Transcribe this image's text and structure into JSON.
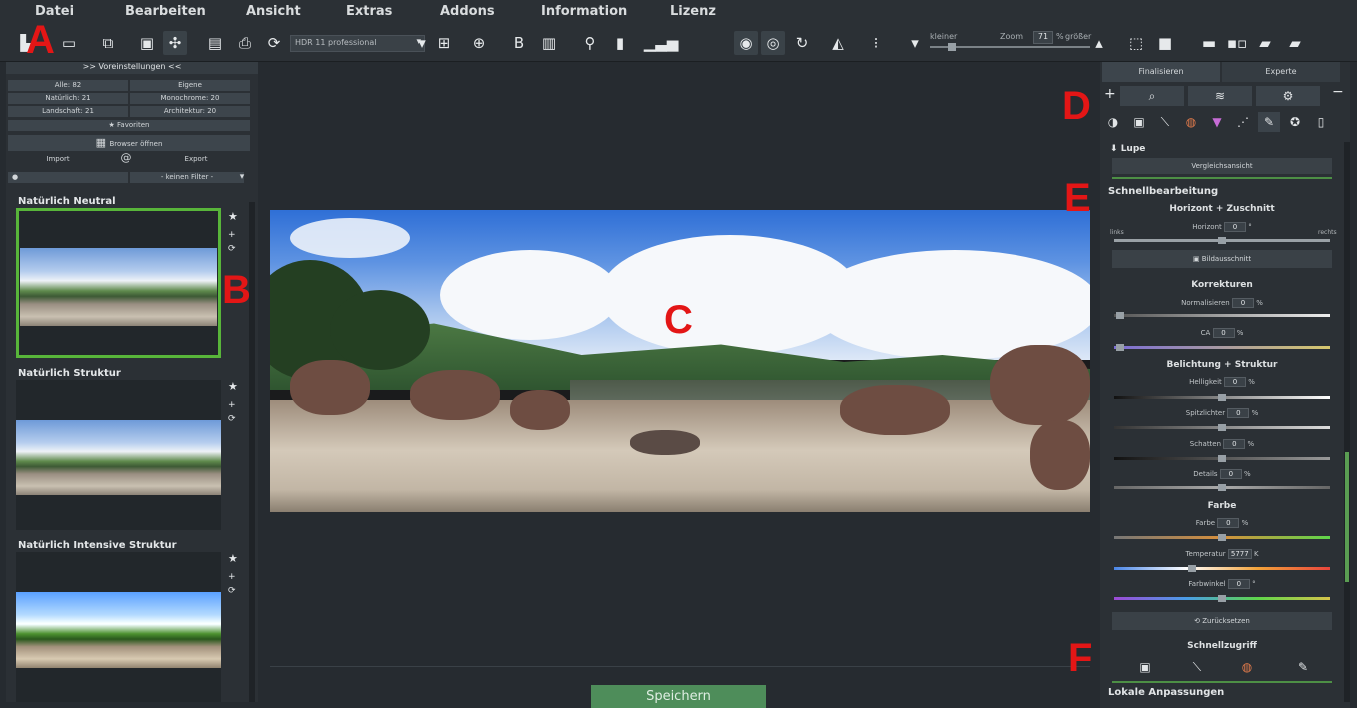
{
  "menu": [
    "Datei",
    "Bearbeiten",
    "Ansicht",
    "Extras",
    "Addons",
    "Information",
    "Lizenz"
  ],
  "toolbar": {
    "preset_select": "HDR 11 professional",
    "zoom_label": "Zoom",
    "zoom_value": "71",
    "zoom_unit": "%",
    "kleiner": "kleiner",
    "groesser": "größer"
  },
  "labels": {
    "a": "A",
    "b": "B",
    "c": "C",
    "d": "D",
    "e": "E",
    "f": "F"
  },
  "left": {
    "title": ">> Voreinstellungen <<",
    "alle": "Alle: 82",
    "eigene": "Eigene",
    "natuerlich": "Natürlich: 21",
    "monochrome": "Monochrome: 20",
    "landschaft": "Landschaft: 21",
    "architektur": "Architektur: 20",
    "favoriten": "Favoriten",
    "browser": "Browser öffnen",
    "import": "Import",
    "at": "@",
    "export": "Export",
    "filter": "- keinen Filter -",
    "presets": [
      "Natürlich Neutral",
      "Natürlich Struktur",
      "Natürlich Intensive Struktur"
    ]
  },
  "save_label": "Speichern",
  "right": {
    "tab1": "Finalisieren",
    "tab2": "Experte",
    "lupe": "Lupe",
    "vergleich": "Vergleichsansicht",
    "schnell": "Schnellbearbeitung",
    "horizont_h": "Horizont + Zuschnitt",
    "horizont": "Horizont",
    "horizont_val": "0",
    "links": "links",
    "rechts": "rechts",
    "bildausschnitt": "Bildausschnitt",
    "korrekturen": "Korrekturen",
    "normalisieren": "Normalisieren",
    "ca": "CA",
    "belichtung": "Belichtung + Struktur",
    "helligkeit": "Helligkeit",
    "spitzlichter": "Spitzlichter",
    "schatten": "Schatten",
    "details": "Details",
    "farbe_h": "Farbe",
    "farbe": "Farbe",
    "temperatur": "Temperatur",
    "temp_val": "5777",
    "farbwinkel": "Farbwinkel",
    "zero": "0",
    "pct": "%",
    "kelvin": "K",
    "deg": "°",
    "zurueck": "Zurücksetzen",
    "schnellzugriff": "Schnellzugriff",
    "lokale": "Lokale Anpassungen"
  }
}
